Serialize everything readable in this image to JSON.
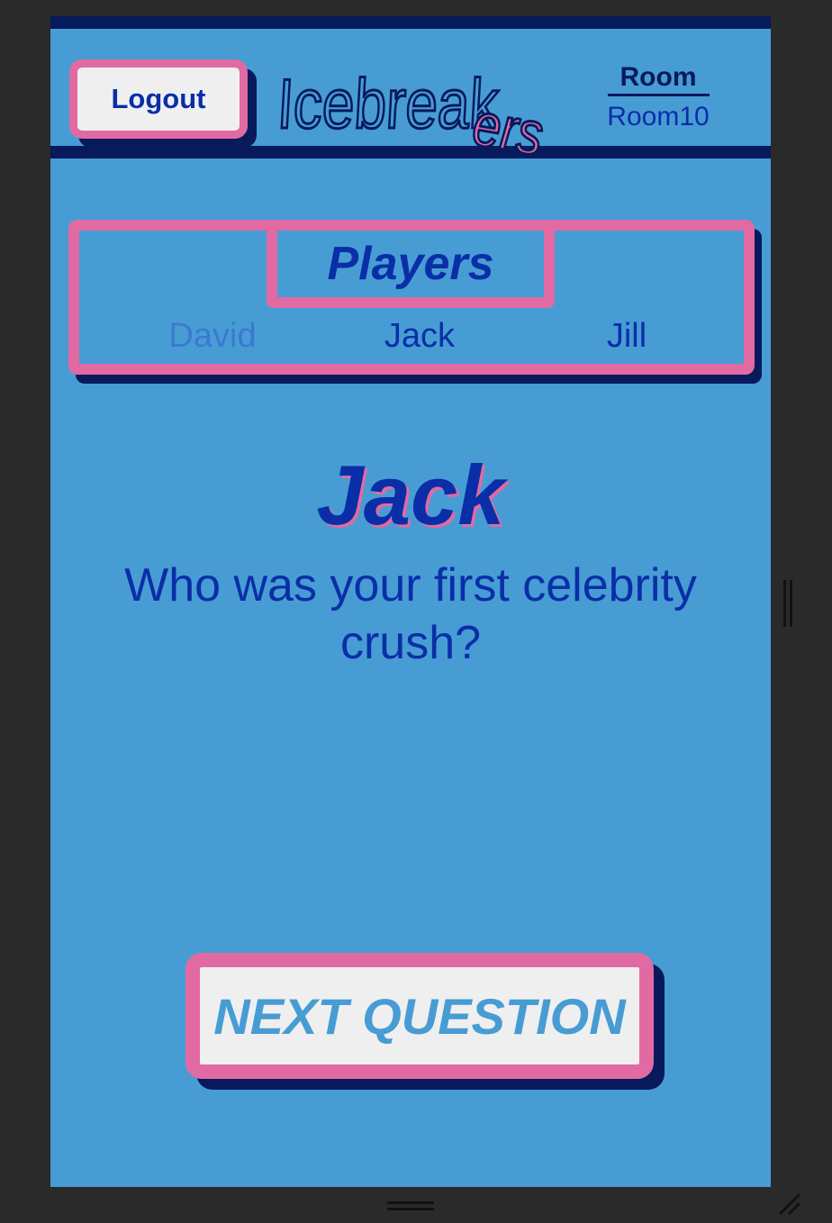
{
  "header": {
    "logout_label": "Logout",
    "logo_text_main": "Icebreak",
    "logo_text_accent": "ers",
    "room_label": "Room",
    "room_name": "Room10"
  },
  "players": {
    "title": "Players",
    "items": [
      {
        "name": "David"
      },
      {
        "name": "Jack"
      },
      {
        "name": "Jill"
      }
    ]
  },
  "turn": {
    "current_player": "Jack",
    "question": "Who was your first celebrity crush?"
  },
  "actions": {
    "next_label": "NEXT QUESTION"
  },
  "colors": {
    "background": "#489cd4",
    "accent_pink": "#e16aa3",
    "navy": "#061a5c",
    "text_blue": "#0a2ea8",
    "button_fill": "#efefef"
  }
}
